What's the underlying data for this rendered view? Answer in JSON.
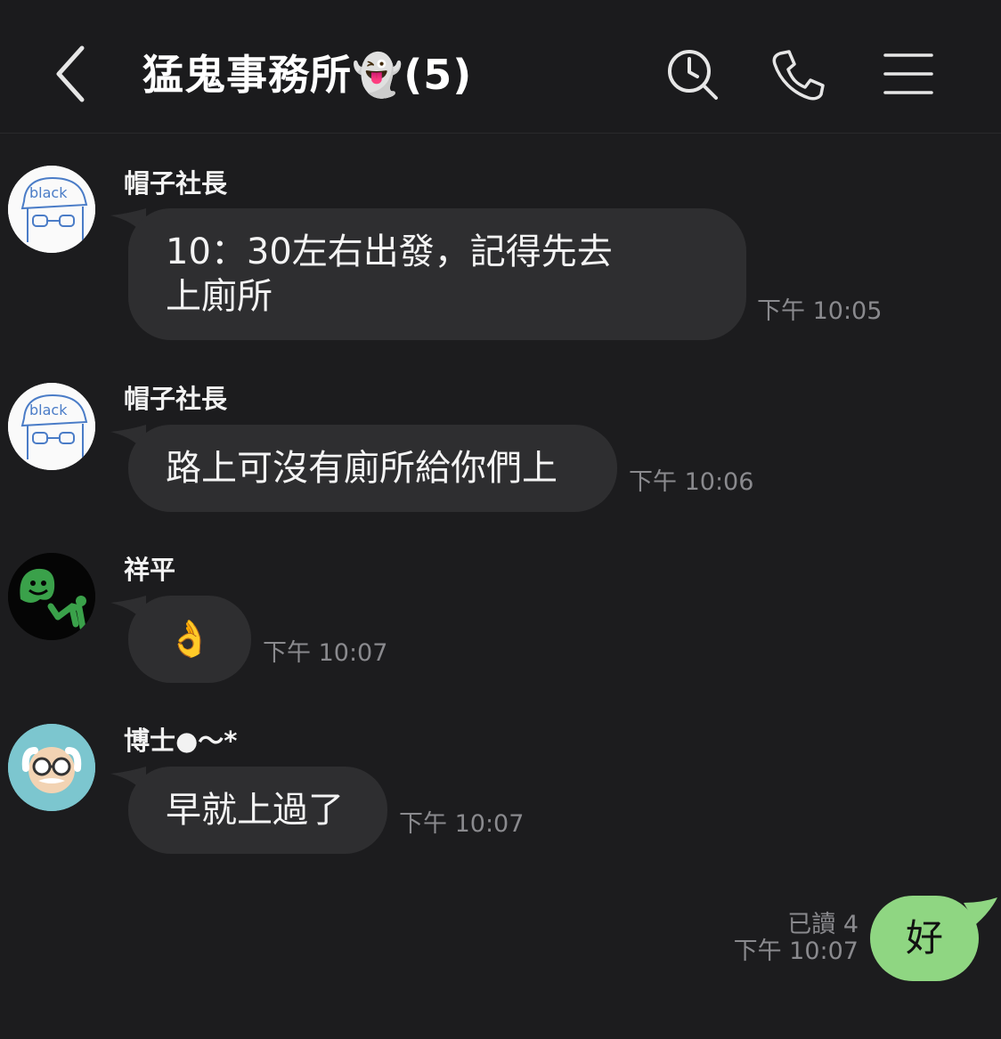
{
  "header": {
    "title": "猛鬼事務所👻(5)",
    "icons": [
      "back-icon",
      "search-icon",
      "phone-icon",
      "menu-icon"
    ]
  },
  "messages": [
    {
      "sender": "帽子社長",
      "text_line1": "10：30左右出發，記得先去",
      "text_line2": "上廁所",
      "time": "下午 10:05",
      "avatar_label": "black"
    },
    {
      "sender": "帽子社長",
      "text": "路上可沒有廁所給你們上",
      "time": "下午 10:06",
      "avatar_label": "black"
    },
    {
      "sender": "祥平",
      "text": "👌",
      "time": "下午 10:07"
    },
    {
      "sender": "博士●～*",
      "text": "早就上過了",
      "time": "下午 10:07"
    }
  ],
  "outgoing": {
    "text": "好",
    "read_status": "已讀 4",
    "time": "下午 10:07"
  },
  "colors": {
    "background": "#1c1c1e",
    "incoming_bubble": "#2e2e30",
    "outgoing_bubble": "#8fd682",
    "timestamp": "#8a8a8e"
  }
}
